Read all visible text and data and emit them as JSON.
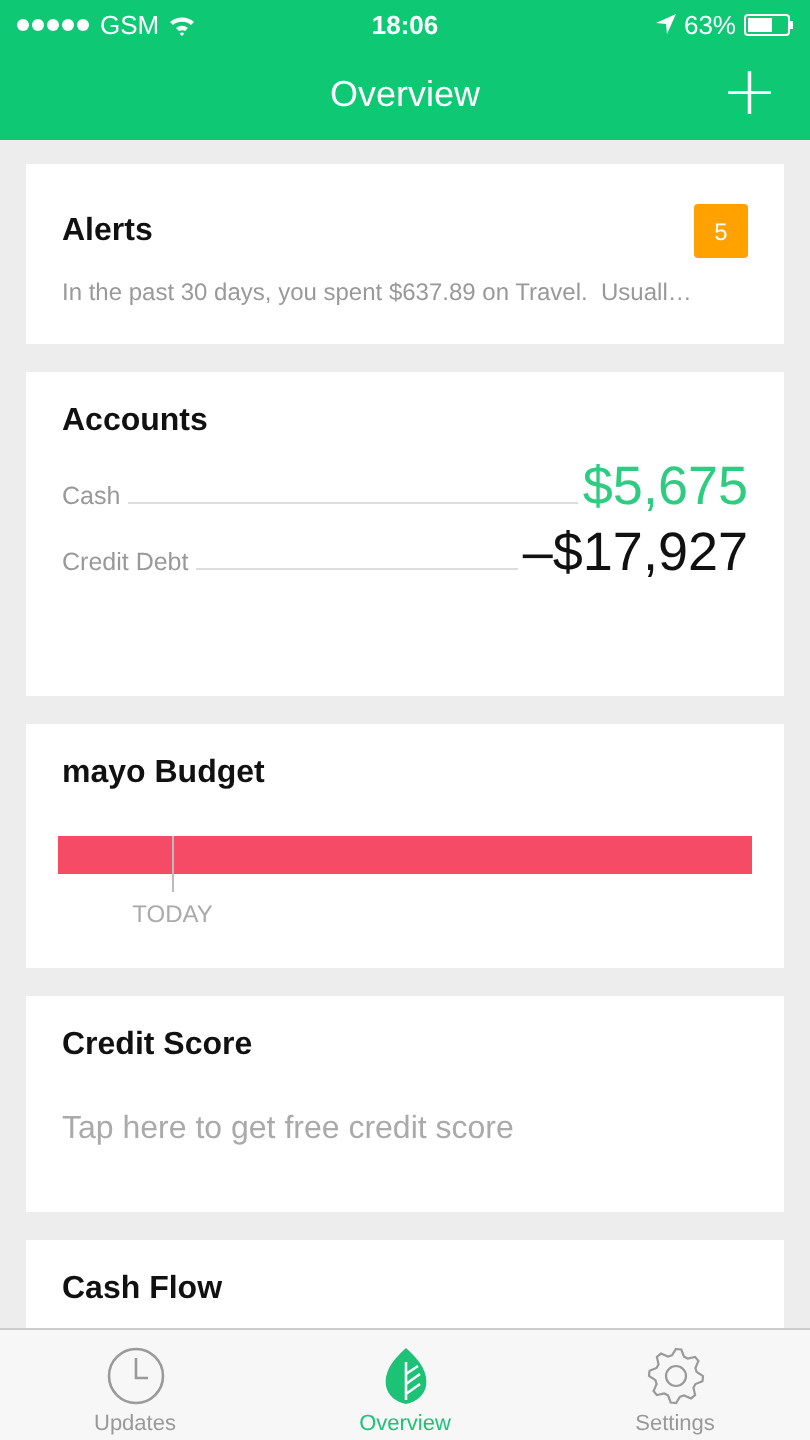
{
  "status_bar": {
    "signal_carrier": "GSM",
    "time": "18:06",
    "battery": "63%"
  },
  "header": {
    "title": "Overview",
    "add_button": "+"
  },
  "alerts": {
    "title": "Alerts",
    "count": "5",
    "message": "In the past 30 days, you spent $637.89 on Travel.  Usuall…"
  },
  "accounts": {
    "title": "Accounts",
    "rows": [
      {
        "label": "Cash",
        "amount": "$5,675",
        "kind": "positive"
      },
      {
        "label": "Credit Debt",
        "amount": "–$17,927",
        "kind": "negative"
      }
    ]
  },
  "budget": {
    "title": "mayo Budget",
    "level": 1,
    "today": {
      "label": "TODAY",
      "level": 0.165
    }
  },
  "credit_score": {
    "title": "Credit Score",
    "message": "Tap here to get free credit score"
  },
  "cash_flow": {
    "title": "Cash Flow"
  },
  "tabs": [
    {
      "label": "Updates",
      "kind": "clock",
      "selected": false
    },
    {
      "label": "Overview",
      "kind": "leaf",
      "selected": true
    },
    {
      "label": "Settings",
      "kind": "gear",
      "selected": false
    }
  ]
}
